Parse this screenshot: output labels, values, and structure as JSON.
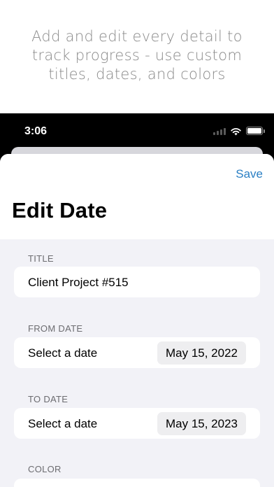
{
  "promo": {
    "caption": "Add and edit every detail to track progress - use custom titles, dates, and colors"
  },
  "status_bar": {
    "time": "3:06",
    "icons": [
      "signal-icon",
      "wifi-icon",
      "battery-icon"
    ]
  },
  "sheet": {
    "save_label": "Save",
    "title": "Edit Date"
  },
  "form": {
    "title_section": {
      "label": "TITLE",
      "value": "Client Project #515"
    },
    "from_section": {
      "label": "FROM DATE",
      "row_label": "Select a date",
      "date": "May 15, 2022"
    },
    "to_section": {
      "label": "TO DATE",
      "row_label": "Select a date",
      "date": "May 15, 2023"
    },
    "color_section": {
      "label": "COLOR"
    }
  },
  "colors": {
    "accent": "#2a7fc4",
    "grouped_background": "#f2f2f7",
    "section_label": "#6c6c70",
    "date_pill": "#eeeef0"
  }
}
